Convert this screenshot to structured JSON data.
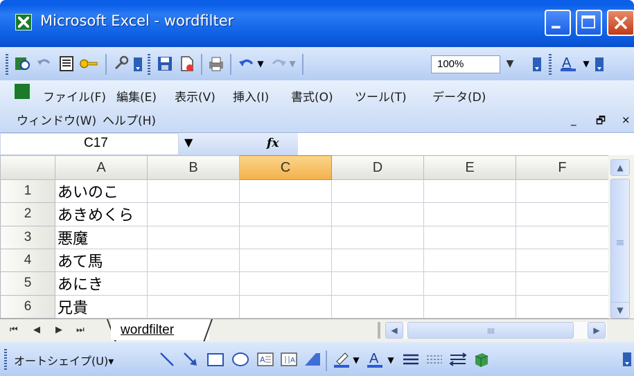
{
  "window": {
    "title": "Microsoft Excel - wordfilter",
    "controls": [
      "minimize",
      "maximize",
      "close"
    ]
  },
  "toolbar": {
    "zoom_value": "100%",
    "icons": [
      "research-icon",
      "undo-icon",
      "form-icon",
      "key-icon",
      "tools-icon",
      "save-icon",
      "new-document-icon",
      "print-icon",
      "undo-icon",
      "redo-icon",
      "font-color-icon"
    ]
  },
  "menu": {
    "items": [
      "ファイル(F)",
      "編集(E)",
      "表示(V)",
      "挿入(I)",
      "書式(O)",
      "ツール(T)",
      "データ(D)",
      "ウィンドウ(W)",
      "ヘルプ(H)"
    ],
    "mdi_minimize": "_",
    "mdi_restore": "🗗",
    "mdi_close": "×"
  },
  "formula_bar": {
    "name_box": "C17",
    "fx_label": "fx",
    "formula": ""
  },
  "grid": {
    "columns": [
      "A",
      "B",
      "C",
      "D",
      "E",
      "F"
    ],
    "active_column": "C",
    "rows": [
      {
        "num": "1",
        "a": "あいのこ"
      },
      {
        "num": "2",
        "a": "あきめくら"
      },
      {
        "num": "3",
        "a": "悪魔"
      },
      {
        "num": "4",
        "a": "あて馬"
      },
      {
        "num": "5",
        "a": "あにき"
      },
      {
        "num": "6",
        "a": "兄貴"
      }
    ]
  },
  "sheets": {
    "tabs": [
      "wordfilter"
    ],
    "active": "wordfilter"
  },
  "draw_toolbar": {
    "autoshape_label": "オートシェイプ(U)▾",
    "icons": [
      "line-icon",
      "arrow-icon",
      "rectangle-icon",
      "oval-icon",
      "textbox-icon",
      "vertical-textbox-icon",
      "wordart-icon",
      "fill-color-icon",
      "font-color-icon",
      "line-style-icon",
      "dash-style-icon",
      "arrow-style-icon",
      "3d-icon"
    ]
  },
  "colors": {
    "title_bar": "#0a5ee8",
    "active_header": "#f3b04a",
    "toolbar": "#c7d9f5"
  }
}
